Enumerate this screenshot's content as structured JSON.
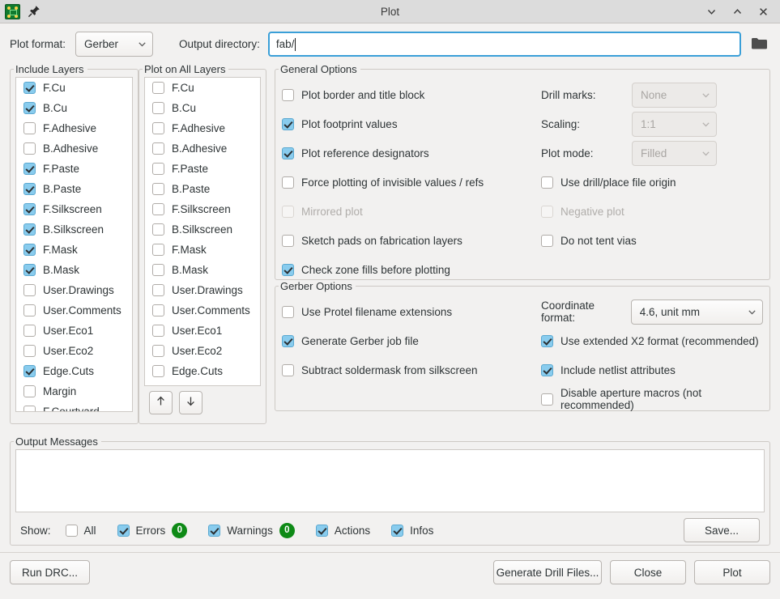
{
  "window": {
    "title": "Plot",
    "app_icon": "kicad-pcb-icon",
    "pin_icon": "pin-icon",
    "minimize_icon": "chevron-down-icon",
    "maximize_icon": "chevron-up-icon",
    "close_icon": "close-icon"
  },
  "toolbar": {
    "plot_format_label": "Plot format:",
    "plot_format_value": "Gerber",
    "output_dir_label": "Output directory:",
    "output_dir_value": "fab/",
    "browse_icon": "folder-icon"
  },
  "include_layers": {
    "title": "Include Layers",
    "items": [
      {
        "label": "F.Cu",
        "checked": true
      },
      {
        "label": "B.Cu",
        "checked": true
      },
      {
        "label": "F.Adhesive",
        "checked": false
      },
      {
        "label": "B.Adhesive",
        "checked": false
      },
      {
        "label": "F.Paste",
        "checked": true
      },
      {
        "label": "B.Paste",
        "checked": true
      },
      {
        "label": "F.Silkscreen",
        "checked": true
      },
      {
        "label": "B.Silkscreen",
        "checked": true
      },
      {
        "label": "F.Mask",
        "checked": true
      },
      {
        "label": "B.Mask",
        "checked": true
      },
      {
        "label": "User.Drawings",
        "checked": false
      },
      {
        "label": "User.Comments",
        "checked": false
      },
      {
        "label": "User.Eco1",
        "checked": false
      },
      {
        "label": "User.Eco2",
        "checked": false
      },
      {
        "label": "Edge.Cuts",
        "checked": true
      },
      {
        "label": "Margin",
        "checked": false
      },
      {
        "label": "F.Courtyard",
        "checked": false
      }
    ]
  },
  "plot_on_all_layers": {
    "title": "Plot on All Layers",
    "items": [
      {
        "label": "F.Cu",
        "checked": false
      },
      {
        "label": "B.Cu",
        "checked": false
      },
      {
        "label": "F.Adhesive",
        "checked": false
      },
      {
        "label": "B.Adhesive",
        "checked": false
      },
      {
        "label": "F.Paste",
        "checked": false
      },
      {
        "label": "B.Paste",
        "checked": false
      },
      {
        "label": "F.Silkscreen",
        "checked": false
      },
      {
        "label": "B.Silkscreen",
        "checked": false
      },
      {
        "label": "F.Mask",
        "checked": false
      },
      {
        "label": "B.Mask",
        "checked": false
      },
      {
        "label": "User.Drawings",
        "checked": false
      },
      {
        "label": "User.Comments",
        "checked": false
      },
      {
        "label": "User.Eco1",
        "checked": false
      },
      {
        "label": "User.Eco2",
        "checked": false
      },
      {
        "label": "Edge.Cuts",
        "checked": false
      }
    ],
    "move_up_icon": "arrow-up-icon",
    "move_down_icon": "arrow-down-icon"
  },
  "general_options": {
    "title": "General Options",
    "left": [
      {
        "label": "Plot border and title block",
        "checked": false,
        "disabled": false
      },
      {
        "label": "Plot footprint values",
        "checked": true,
        "disabled": false
      },
      {
        "label": "Plot reference designators",
        "checked": true,
        "disabled": false
      },
      {
        "label": "Force plotting of invisible values / refs",
        "checked": false,
        "disabled": false
      },
      {
        "label": "Mirrored plot",
        "checked": false,
        "disabled": true
      },
      {
        "label": "Sketch pads on fabrication layers",
        "checked": false,
        "disabled": false
      },
      {
        "label": "Check zone fills before plotting",
        "checked": true,
        "disabled": false
      }
    ],
    "drill_marks_label": "Drill marks:",
    "drill_marks_value": "None",
    "scaling_label": "Scaling:",
    "scaling_value": "1:1",
    "plot_mode_label": "Plot mode:",
    "plot_mode_value": "Filled",
    "right_checks": [
      {
        "label": "Use drill/place file origin",
        "checked": false,
        "disabled": false
      },
      {
        "label": "Negative plot",
        "checked": false,
        "disabled": true
      },
      {
        "label": "Do not tent vias",
        "checked": false,
        "disabled": false
      }
    ]
  },
  "gerber_options": {
    "title": "Gerber Options",
    "left": [
      {
        "label": "Use Protel filename extensions",
        "checked": false
      },
      {
        "label": "Generate Gerber job file",
        "checked": true
      },
      {
        "label": "Subtract soldermask from silkscreen",
        "checked": false
      }
    ],
    "coordinate_format_label": "Coordinate format:",
    "coordinate_format_value": "4.6, unit mm",
    "right_checks": [
      {
        "label": "Use extended X2 format (recommended)",
        "checked": true
      },
      {
        "label": "Include netlist attributes",
        "checked": true
      },
      {
        "label": "Disable aperture macros (not recommended)",
        "checked": false
      }
    ]
  },
  "output_messages": {
    "title": "Output Messages",
    "content": "",
    "show_label": "Show:",
    "filters": [
      {
        "label": "All",
        "checked": false,
        "badge": null
      },
      {
        "label": "Errors",
        "checked": true,
        "badge": "0"
      },
      {
        "label": "Warnings",
        "checked": true,
        "badge": "0"
      },
      {
        "label": "Actions",
        "checked": true,
        "badge": null
      },
      {
        "label": "Infos",
        "checked": true,
        "badge": null
      }
    ],
    "save_label": "Save..."
  },
  "footer": {
    "run_drc_label": "Run DRC...",
    "generate_drill_label": "Generate Drill Files...",
    "close_label": "Close",
    "plot_label": "Plot"
  },
  "colors": {
    "accent_checkbox": "#89ccee",
    "focus_border": "#3a9fd8",
    "badge_green": "#0e8a16",
    "window_bg": "#f2f1f0",
    "titlebar_bg": "#dcdcdc"
  }
}
